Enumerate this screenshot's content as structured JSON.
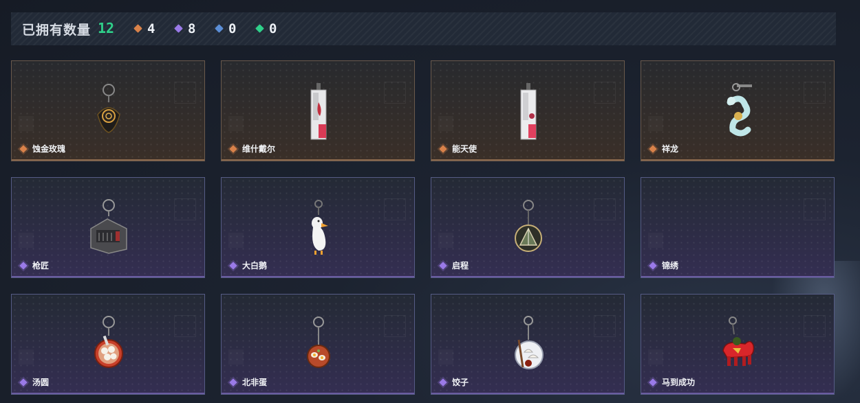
{
  "header": {
    "owned_label": "已拥有数量",
    "owned_count": "12",
    "stats": [
      {
        "icon": "orange-diamond-icon",
        "color": "#d9824a",
        "value": "4"
      },
      {
        "icon": "purple-diamond-icon",
        "color": "#9a7ae8",
        "value": "8"
      },
      {
        "icon": "blue-diamond-icon",
        "color": "#5b8ed6",
        "value": "0"
      },
      {
        "icon": "green-diamond-icon",
        "color": "#2fd08a",
        "value": "0"
      }
    ]
  },
  "items": [
    {
      "name": "蚀金玫瑰",
      "rarity": "orange",
      "icon": "black-rose-charm-icon"
    },
    {
      "name": "维什戴尔",
      "rarity": "orange",
      "icon": "tag-charm-icon"
    },
    {
      "name": "能天使",
      "rarity": "orange",
      "icon": "tag-charm-icon"
    },
    {
      "name": "祥龙",
      "rarity": "orange",
      "icon": "dragon-charm-icon"
    },
    {
      "name": "枪匠",
      "rarity": "purple",
      "icon": "gunsmith-charm-icon"
    },
    {
      "name": "大白鹅",
      "rarity": "purple",
      "icon": "goose-charm-icon"
    },
    {
      "name": "启程",
      "rarity": "purple",
      "icon": "medallion-charm-icon"
    },
    {
      "name": "锦绣",
      "rarity": "purple",
      "icon": ""
    },
    {
      "name": "汤圆",
      "rarity": "purple",
      "icon": "tangyuan-bowl-charm-icon"
    },
    {
      "name": "北非蛋",
      "rarity": "purple",
      "icon": "shakshuka-charm-icon"
    },
    {
      "name": "饺子",
      "rarity": "purple",
      "icon": "dumpling-plate-charm-icon"
    },
    {
      "name": "马到成功",
      "rarity": "purple",
      "icon": "red-horse-charm-icon"
    }
  ],
  "colors": {
    "orange": "#d9824a",
    "purple": "#9a7ae8",
    "owned_count": "#2fd08a"
  }
}
